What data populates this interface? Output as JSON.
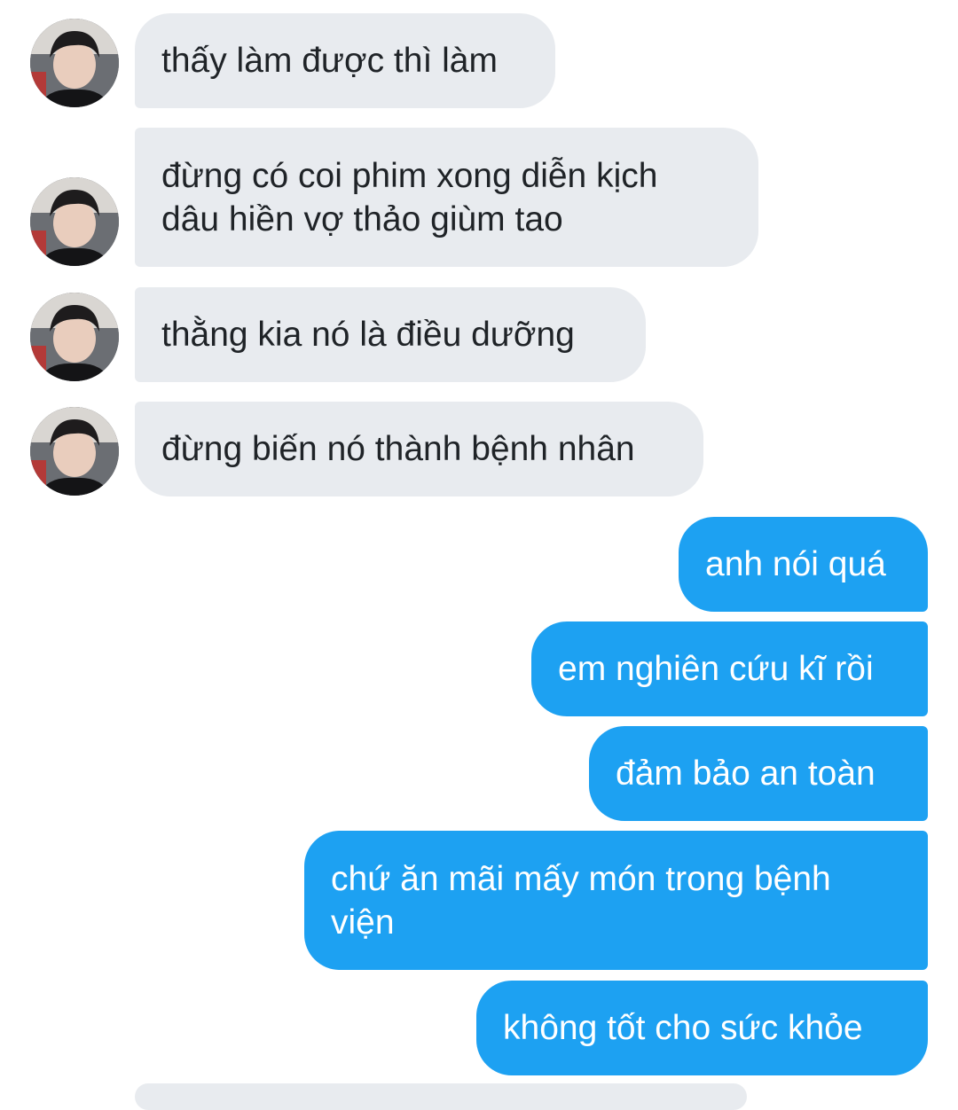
{
  "conversation": {
    "contact": {
      "avatar_icon": "profile-photo-avatar"
    },
    "colors": {
      "incoming_bubble": "#e8ebef",
      "outgoing_bubble": "#1da1f2",
      "incoming_text": "#1f2327",
      "outgoing_text": "#ffffff"
    },
    "messages": [
      {
        "direction": "incoming",
        "text": "thấy làm được thì làm"
      },
      {
        "direction": "incoming",
        "text": "đừng có coi phim xong diễn kịch\ndâu hiền vợ thảo giùm tao"
      },
      {
        "direction": "incoming",
        "text": "thằng kia nó là điều dưỡng"
      },
      {
        "direction": "incoming",
        "text": "đừng biến nó thành bệnh nhân"
      },
      {
        "direction": "outgoing",
        "text": "anh nói quá"
      },
      {
        "direction": "outgoing",
        "text": "em nghiên cứu kĩ rồi"
      },
      {
        "direction": "outgoing",
        "text": "đảm bảo an toàn"
      },
      {
        "direction": "outgoing",
        "text": "chứ ăn mãi mấy món trong bệnh\nviện"
      },
      {
        "direction": "outgoing",
        "text": "không tốt cho sức khỏe"
      }
    ]
  }
}
